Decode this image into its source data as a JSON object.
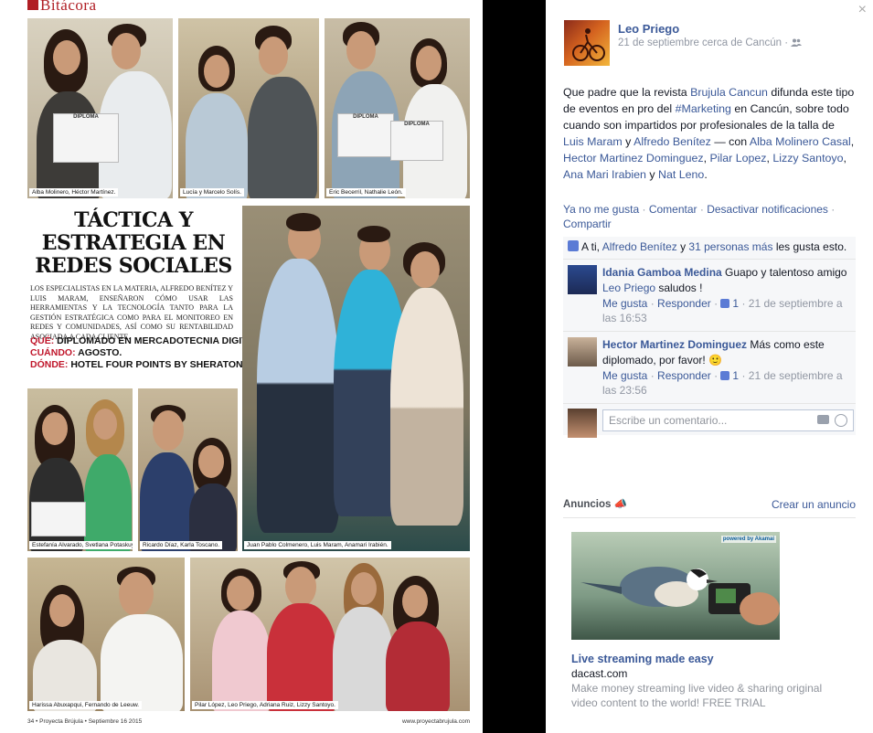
{
  "magazine": {
    "logo": "Bitácora",
    "captions": [
      "Alba Molinero, Héctor Martínez.",
      "Lucía y Marcelo Solís.",
      "Eric Becerril, Nathalie León.",
      "Juan Pablo Colmenero, Luis Maram, Anamari Irabién.",
      "Estefanía Alvarado, Svetlana Potaskuyeva.",
      "Ricardo Díaz, Karla Toscano.",
      "Harissa Abuxapqui, Fernando de Leeuw.",
      "Pilar López, Leo Priego, Adriana Ruiz, Lizzy Santoyo."
    ],
    "diploma_label": "DIPLOMA",
    "title": "TÁCTICA Y ESTRATEGIA EN REDES SOCIALES",
    "body": "Los especialistas en la materia, Alfredo Benítez y Luis Maram, enseñaron cómo usar las herramientas y la tecnología tanto para la gestión estratégica como para el monitoreo en redes y comunidades, así como su rentabilidad asociada a cada cliente.",
    "info": [
      {
        "key": "QUÉ:",
        "value": "DIPLOMADO EN MERCADOTECNIA DIGITAL."
      },
      {
        "key": "CUÁNDO:",
        "value": "AGOSTO."
      },
      {
        "key": "DÓNDE:",
        "value": "HOTEL FOUR POINTS BY SHERATON."
      }
    ],
    "footer_left": "34 • Proyecta Brújula • Septiembre 16 2015",
    "footer_right": "www.proyectabrujula.com"
  },
  "facebook": {
    "close": "×",
    "poster_name": "Leo Priego",
    "meta": "21 de septiembre cerca de Cancún ·",
    "post": {
      "t1": "Que padre que la revista ",
      "l1": "Brujula Cancun",
      "t2": " difunda este tipo de eventos en pro del ",
      "l2": "#Marketing",
      "t3": " en Cancún, sobre todo cuando son impartidos por profesionales de la talla de ",
      "l3": "Luis Maram",
      "t4": " y ",
      "l4": "Alfredo Benítez",
      "t5": " — con ",
      "l5": "Alba Molinero Casal",
      "t6": ", ",
      "l6": "Hector Martinez Dominguez",
      "t7": ", ",
      "l7": "Pilar Lopez",
      "t8": ", ",
      "l8": "Lizzy Santoyo",
      "t9": ", ",
      "l9": "Ana Mari Irabien",
      "t10": " y ",
      "l10": "Nat Leno",
      "t11": "."
    },
    "actions": {
      "unlike": "Ya no me gusta",
      "comment": "Comentar",
      "notifications": "Desactivar notificaciones",
      "share": "Compartir"
    },
    "likes": {
      "prefix": "A ti, ",
      "name": "Alfredo Benítez",
      "mid": " y ",
      "count": "31 personas más",
      "suffix": " les gusta esto."
    },
    "comments": [
      {
        "author": "Idania Gamboa Medina",
        "text1": " Guapo y talentoso amigo ",
        "mention": "Leo Priego",
        "text2": " saludos !",
        "like": "Me gusta",
        "reply": "Responder",
        "likes": "1",
        "time": "21 de septiembre a las 16:53"
      },
      {
        "author": "Hector Martinez Dominguez",
        "text1": " Más como este diplomado, por favor! 🙂",
        "mention": "",
        "text2": "",
        "like": "Me gusta",
        "reply": "Responder",
        "likes": "1",
        "time": "21 de septiembre a las 23:56"
      }
    ],
    "write_placeholder": "Escribe un comentario...",
    "ads": {
      "label": "Anuncios",
      "create": "Crear un anuncio",
      "brand_badge": "powered by Akamai",
      "title": "Live streaming made easy",
      "domain": "dacast.com",
      "description": "Make money streaming live video & sharing original video content to the world! FREE TRIAL"
    },
    "colors": {
      "link": "#3b5998",
      "muted": "#9197a3",
      "accent_red": "#c0162b"
    }
  }
}
